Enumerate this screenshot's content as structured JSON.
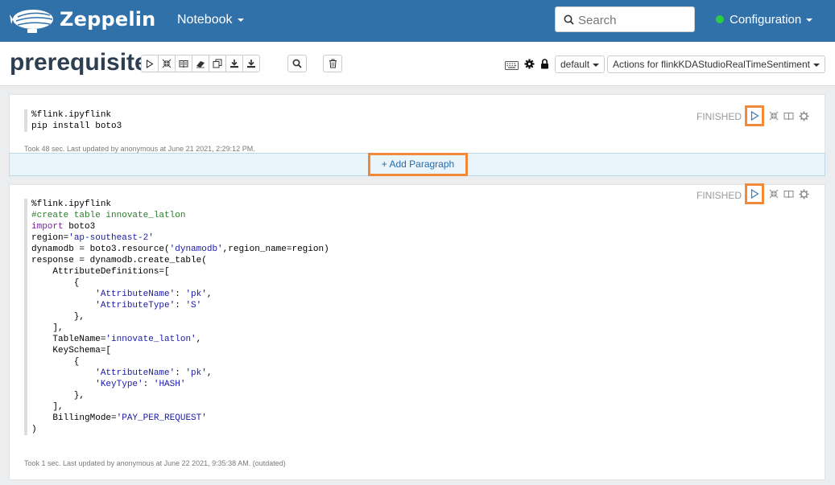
{
  "navbar": {
    "brand": "Zeppelin",
    "notebook_menu": "Notebook",
    "search_placeholder": "Search",
    "configuration": "Configuration",
    "status_color": "#2ecc40"
  },
  "header": {
    "title": "prerequisite",
    "toolbar_icons": [
      "run-all-icon",
      "hide-code-icon",
      "hide-output-icon",
      "clear-output-icon",
      "clone-icon",
      "export-icon",
      "import-icon"
    ],
    "interpreter": "default",
    "actions": "Actions for flinkKDAStudioRealTimeSentiment"
  },
  "paragraphs": [
    {
      "status": "FINISHED",
      "code_lines": [
        "%flink.ipyflink",
        "pip install boto3"
      ],
      "footer": "Took 48 sec. Last updated by anonymous at June 21 2021, 2:29:12 PM."
    },
    {
      "status": "FINISHED",
      "code_lines": [
        "%flink.ipyflink",
        "#create table innovate_latlon",
        "import boto3",
        "region='ap-southeast-2'",
        "dynamodb = boto3.resource('dynamodb',region_name=region)",
        "response = dynamodb.create_table(",
        "    AttributeDefinitions=[",
        "        {",
        "            'AttributeName': 'pk',",
        "            'AttributeType': 'S'",
        "        },",
        "    ],",
        "    TableName='innovate_latlon',",
        "    KeySchema=[",
        "        {",
        "            'AttributeName': 'pk',",
        "            'KeyType': 'HASH'",
        "        },",
        "    ],",
        "    BillingMode='PAY_PER_REQUEST'",
        ")"
      ],
      "footer": "Took 1 sec. Last updated by anonymous at June 22 2021, 9:35:38 AM. (outdated)"
    }
  ],
  "add_paragraph": "+ Add Paragraph",
  "colors": {
    "navbar": "#3071a9",
    "highlight": "#f08a3a",
    "title": "#2c3e50"
  }
}
